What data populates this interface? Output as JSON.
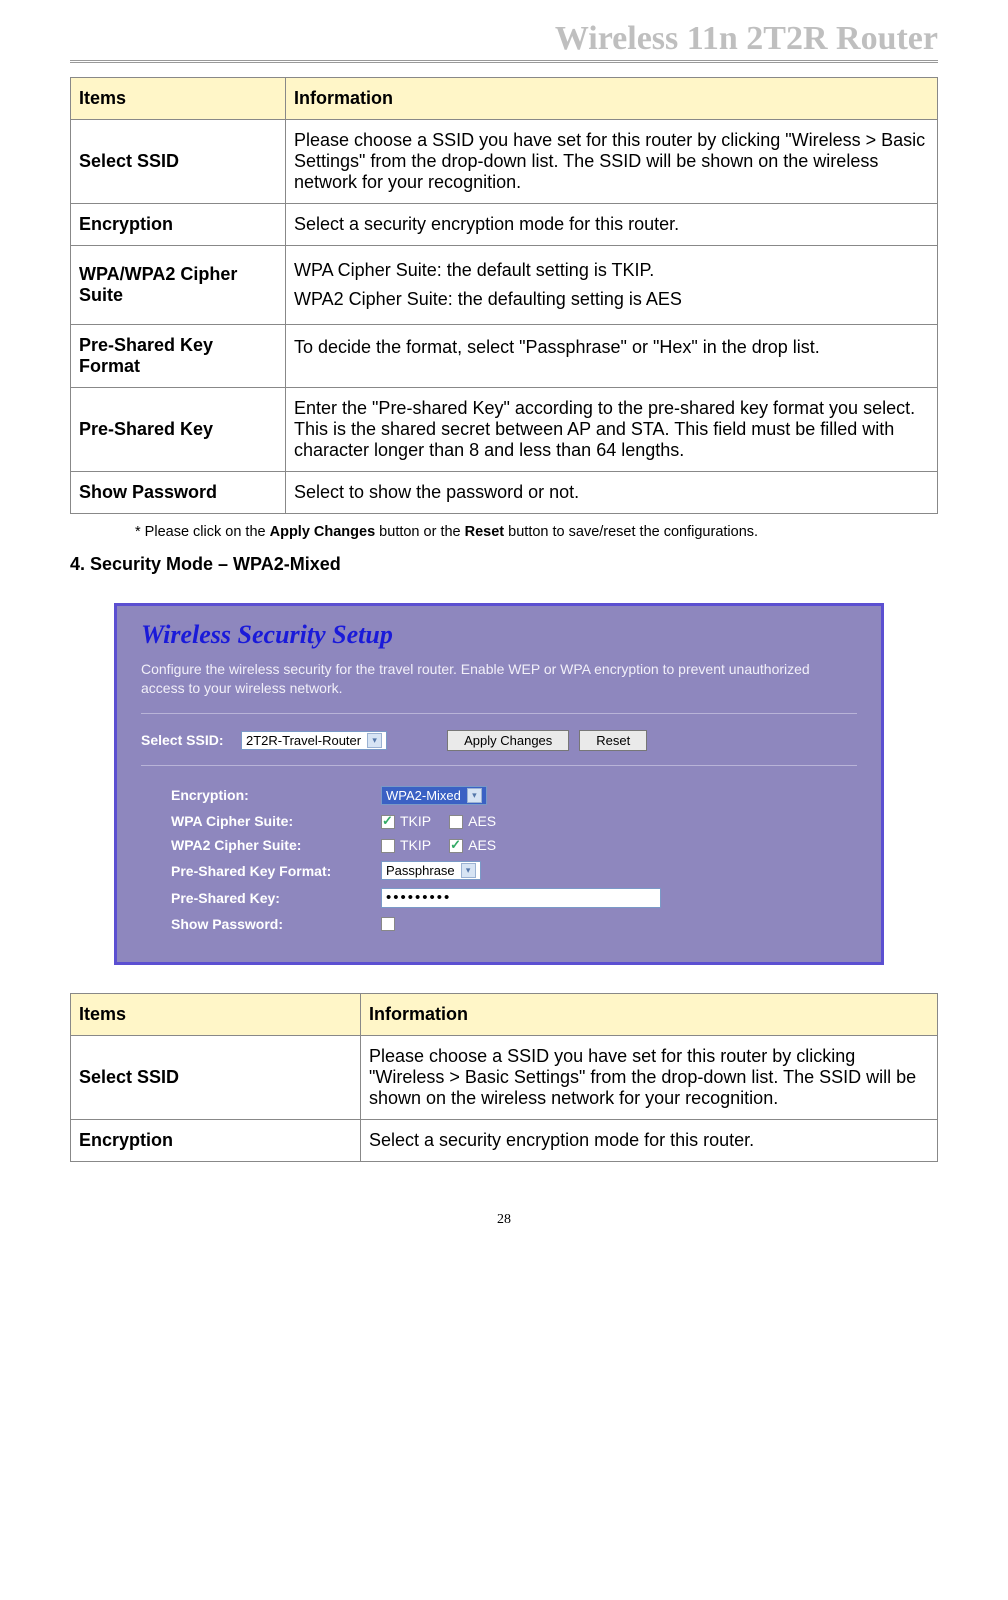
{
  "header": {
    "title": "Wireless 11n 2T2R Router"
  },
  "table1": {
    "headers": [
      "Items",
      "Information"
    ],
    "rows": [
      {
        "item": "Select SSID",
        "info": "Please choose a SSID you have set for this router by clicking \"Wireless > Basic Settings\" from the drop-down list. The SSID will be shown on the wireless network for your recognition."
      },
      {
        "item": "Encryption",
        "info": "Select a security encryption mode for this router."
      },
      {
        "item": "WPA/WPA2 Cipher Suite",
        "info": "WPA Cipher Suite: the default setting is TKIP.\nWPA2 Cipher Suite: the defaulting setting is AES"
      },
      {
        "item": "Pre-Shared Key Format",
        "info": "To decide the format, select \"Passphrase\" or \"Hex\" in the drop list."
      },
      {
        "item": "Pre-Shared Key",
        "info": "Enter the \"Pre-shared Key\" according to the pre-shared key format you select. This is the shared secret between AP and STA. This field must be filled with character longer than 8 and less than 64 lengths."
      },
      {
        "item": "Show Password",
        "info": "Select to show the password or not."
      }
    ]
  },
  "note": {
    "prefix": "* Please click on the ",
    "b1": "Apply Changes",
    "mid": " button or the ",
    "b2": "Reset",
    "suffix": " button to save/reset the configurations."
  },
  "section_heading": "4.  Security Mode – WPA2-Mixed",
  "screenshot": {
    "title": "Wireless Security Setup",
    "desc": "Configure the wireless security for the travel router. Enable WEP or WPA encryption to prevent unauthorized access to your wireless network.",
    "ssid_label": "Select SSID:",
    "ssid_value": "2T2R-Travel-Router",
    "apply_btn": "Apply Changes",
    "reset_btn": "Reset",
    "encryption_label": "Encryption:",
    "encryption_value": "WPA2-Mixed",
    "wpa_label": "WPA Cipher Suite:",
    "wpa2_label": "WPA2 Cipher Suite:",
    "opt_tkip": "TKIP",
    "opt_aes": "AES",
    "psk_format_label": "Pre-Shared Key Format:",
    "psk_format_value": "Passphrase",
    "psk_label": "Pre-Shared Key:",
    "psk_value": "•••••••••",
    "show_pw_label": "Show Password:"
  },
  "table2": {
    "headers": [
      "Items",
      "Information"
    ],
    "rows": [
      {
        "item": "Select SSID",
        "info": "Please choose a SSID you have set for this router by clicking \"Wireless > Basic Settings\" from the drop-down list. The SSID will be shown on the wireless network for your recognition."
      },
      {
        "item": "Encryption",
        "info": "Select a security encryption mode for this router."
      }
    ]
  },
  "page_number": "28"
}
